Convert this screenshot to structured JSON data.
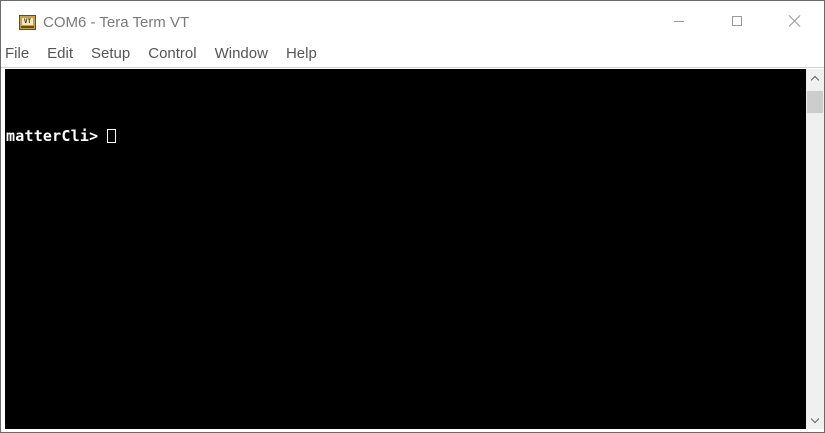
{
  "window": {
    "title": "COM6 - Tera Term VT",
    "app_icon": "tera-term-icon",
    "app_icon_text": "VT"
  },
  "menu": {
    "items": [
      {
        "label": "File"
      },
      {
        "label": "Edit"
      },
      {
        "label": "Setup"
      },
      {
        "label": "Control"
      },
      {
        "label": "Window"
      },
      {
        "label": "Help"
      }
    ]
  },
  "terminal": {
    "prompt": "matterCli>",
    "background": "#000000",
    "foreground": "#ffffff"
  },
  "controls": {
    "minimize_icon": "minimize-icon",
    "maximize_icon": "maximize-icon",
    "close_icon": "close-icon"
  }
}
